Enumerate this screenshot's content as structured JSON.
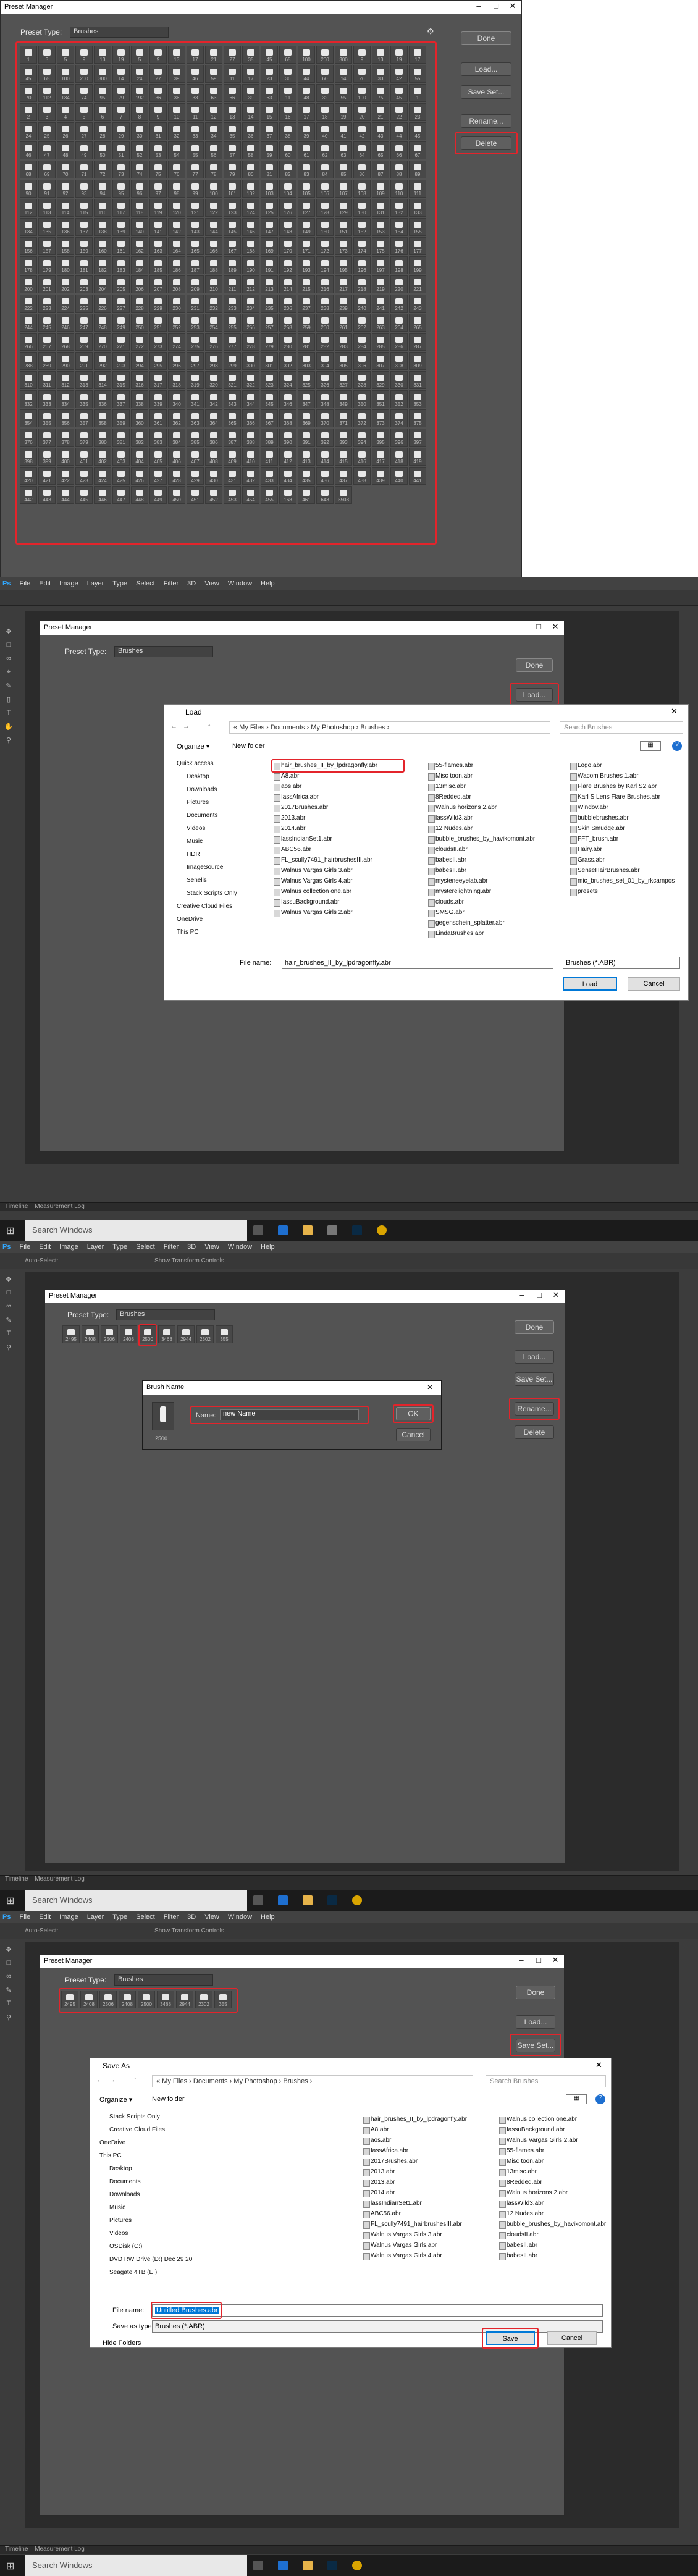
{
  "panel1": {
    "title": "Preset Manager",
    "preset_type_label": "Preset Type:",
    "preset_type_value": "Brushes",
    "buttons": {
      "done": "Done",
      "load": "Load...",
      "save": "Save Set...",
      "rename": "Rename...",
      "delete": "Delete"
    },
    "cell_labels": [
      "1",
      "3",
      "5",
      "9",
      "13",
      "19",
      "5",
      "9",
      "13",
      "17",
      "21",
      "27",
      "35",
      "45",
      "65",
      "100",
      "200",
      "300",
      "9",
      "13",
      "19",
      "17",
      "45",
      "65",
      "100",
      "200",
      "300",
      "14",
      "24",
      "27",
      "39",
      "46",
      "59",
      "11",
      "17",
      "23",
      "36",
      "44",
      "60",
      "14",
      "26",
      "33",
      "42",
      "55",
      "70",
      "112",
      "134",
      "74",
      "95",
      "29",
      "192",
      "36",
      "36",
      "33",
      "63",
      "66",
      "39",
      "63",
      "11",
      "48",
      "32",
      "55",
      "100",
      "75",
      "45",
      "1",
      "2",
      "3",
      "4",
      "5",
      "6",
      "7",
      "8",
      "9",
      "10",
      "11",
      "12",
      "13",
      "14",
      "15",
      "16",
      "17",
      "18",
      "19",
      "20",
      "21",
      "22",
      "23",
      "24",
      "25",
      "26",
      "27",
      "28",
      "29",
      "30",
      "31",
      "32",
      "33",
      "34",
      "35",
      "36",
      "37",
      "38",
      "39",
      "40",
      "41",
      "42",
      "43",
      "44",
      "45",
      "46",
      "47",
      "48",
      "49",
      "50",
      "51",
      "52",
      "53",
      "54",
      "55",
      "56",
      "57",
      "58",
      "59",
      "60",
      "61",
      "62",
      "63",
      "64",
      "65",
      "66",
      "67",
      "68",
      "69",
      "70",
      "71",
      "72",
      "73",
      "74",
      "75",
      "76",
      "77",
      "78",
      "79",
      "80",
      "81",
      "82",
      "83",
      "84",
      "85",
      "86",
      "87",
      "88",
      "89",
      "90",
      "91",
      "92",
      "93",
      "94",
      "95",
      "96",
      "97",
      "98",
      "99",
      "100",
      "101",
      "102",
      "103",
      "104",
      "105",
      "106",
      "107",
      "108",
      "109",
      "110",
      "111",
      "112",
      "113",
      "114",
      "115",
      "116",
      "117",
      "118",
      "119",
      "120",
      "121",
      "122",
      "123",
      "124",
      "125",
      "126",
      "127",
      "128",
      "129",
      "130",
      "131",
      "132",
      "133",
      "134",
      "135",
      "136",
      "137",
      "138",
      "139",
      "140",
      "141",
      "142",
      "143",
      "144",
      "145",
      "146",
      "147",
      "148",
      "149",
      "150",
      "151",
      "152",
      "153",
      "154",
      "155",
      "156",
      "157",
      "158",
      "159",
      "160",
      "161",
      "162",
      "163",
      "164",
      "165",
      "166",
      "167",
      "168",
      "169",
      "170",
      "171",
      "172",
      "173",
      "174",
      "175",
      "176",
      "177",
      "178",
      "179",
      "180",
      "181",
      "182",
      "183",
      "184",
      "185",
      "186",
      "187",
      "188",
      "189",
      "190",
      "191",
      "192",
      "193",
      "194",
      "195",
      "196",
      "197",
      "198",
      "199",
      "200",
      "201",
      "202",
      "203",
      "204",
      "205",
      "206",
      "207",
      "208",
      "209",
      "210",
      "211",
      "212",
      "213",
      "214",
      "215",
      "216",
      "217",
      "218",
      "219",
      "220",
      "221",
      "222",
      "223",
      "224",
      "225",
      "226",
      "227",
      "228",
      "229",
      "230",
      "231",
      "232",
      "233",
      "234",
      "235",
      "236",
      "237",
      "238",
      "239",
      "240",
      "241",
      "242",
      "243",
      "244",
      "245",
      "246",
      "247",
      "248",
      "249",
      "250",
      "251",
      "252",
      "253",
      "254",
      "255",
      "256",
      "257",
      "258",
      "259",
      "260",
      "261",
      "262",
      "263",
      "264",
      "265",
      "266",
      "267",
      "268",
      "269",
      "270",
      "271",
      "272",
      "273",
      "274",
      "275",
      "276",
      "277",
      "278",
      "279",
      "280",
      "281",
      "282",
      "283",
      "284",
      "285",
      "286",
      "287",
      "288",
      "289",
      "290",
      "291",
      "292",
      "293",
      "294",
      "295",
      "296",
      "297",
      "298",
      "299",
      "300",
      "301",
      "302",
      "303",
      "304",
      "305",
      "306",
      "307",
      "308",
      "309",
      "310",
      "311",
      "312",
      "313",
      "314",
      "315",
      "316",
      "317",
      "318",
      "319",
      "320",
      "321",
      "322",
      "323",
      "324",
      "325",
      "326",
      "327",
      "328",
      "329",
      "330",
      "331",
      "332",
      "333",
      "334",
      "335",
      "336",
      "337",
      "338",
      "339",
      "340",
      "341",
      "342",
      "343",
      "344",
      "345",
      "346",
      "347",
      "348",
      "349",
      "350",
      "351",
      "352",
      "353",
      "354",
      "355",
      "356",
      "357",
      "358",
      "359",
      "360",
      "361",
      "362",
      "363",
      "364",
      "365",
      "366",
      "367",
      "368",
      "369",
      "370",
      "371",
      "372",
      "373",
      "374",
      "375",
      "376",
      "377",
      "378",
      "379",
      "380",
      "381",
      "382",
      "383",
      "384",
      "385",
      "386",
      "387",
      "388",
      "389",
      "390",
      "391",
      "392",
      "393",
      "394",
      "395",
      "396",
      "397",
      "398",
      "399",
      "400",
      "401",
      "402",
      "403",
      "404",
      "405",
      "406",
      "407",
      "408",
      "409",
      "410",
      "411",
      "412",
      "413",
      "414",
      "415",
      "416",
      "417",
      "418",
      "419",
      "420",
      "421",
      "422",
      "423",
      "424",
      "425",
      "426",
      "427",
      "428",
      "429",
      "430",
      "431",
      "432",
      "433",
      "434",
      "435",
      "436",
      "437",
      "438",
      "439",
      "440",
      "441",
      "442",
      "443",
      "444",
      "445",
      "446",
      "447",
      "448",
      "449",
      "450",
      "451",
      "452",
      "453",
      "454",
      "455",
      "456",
      "457",
      "458",
      "459",
      "460",
      "461",
      "462",
      "463",
      "464",
      "465",
      "466",
      "467",
      "468",
      "469",
      "470",
      "471",
      "472",
      "473",
      "474",
      "475",
      "476",
      "477",
      "478",
      "479",
      "480",
      "481",
      "482",
      "483",
      "484",
      "485",
      "486",
      "487",
      "488",
      "489",
      "490",
      "491",
      "492",
      "493",
      "494",
      "495",
      "496",
      "497",
      "498",
      "499",
      "500"
    ],
    "last_row_labels": [
      "168",
      "461",
      "643",
      "3508"
    ]
  },
  "menu": [
    "File",
    "Edit",
    "Image",
    "Layer",
    "Type",
    "Select",
    "Filter",
    "3D",
    "View",
    "Window",
    "Help"
  ],
  "ps_logo": "Ps",
  "status_tabs": {
    "timeline": "Timeline",
    "measurement": "Measurement Log"
  },
  "taskbar": {
    "search": "Search Windows"
  },
  "options": {
    "auto_select": "Auto-Select:",
    "layer": "Layer",
    "transform": "Show Transform Controls"
  },
  "panel2": {
    "pm_title": "Preset Manager",
    "preset_type_label": "Preset Type:",
    "preset_type_value": "Brushes",
    "buttons": {
      "done": "Done",
      "load": "Load..."
    },
    "load_dialog": {
      "title": "Load",
      "breadcrumb": "« My Files › Documents › My Photoshop › Brushes ›",
      "search_placeholder": "Search Brushes",
      "organize": "Organize ▾",
      "new_folder": "New folder",
      "nav": [
        "Quick access",
        "Desktop",
        "Downloads",
        "Pictures",
        "Documents",
        "Videos",
        "Music",
        "HDR",
        "ImageSource",
        "Senelis",
        "Stack Scripts Only",
        "Creative Cloud Files",
        "OneDrive",
        "This PC"
      ],
      "files_col1": [
        "hair_brushes_II_by_lpdragonfly.abr",
        "A8.abr",
        "aos.abr",
        "IassAfrica.abr",
        "2017Brushes.abr",
        "2013.abr",
        "2014.abr",
        "lassIndianSet1.abr",
        "ABC56.abr",
        "FL_scully7491_hairbrushesIII.abr",
        "Walnus Vargas Girls 3.abr",
        "Walnus Vargas Girls 4.abr",
        "Walnus collection one.abr",
        "IassuBackground.abr",
        "Walnus Vargas Girls 2.abr"
      ],
      "files_col2": [
        "55-flames.abr",
        "Misc toon.abr",
        "13misc.abr",
        "8Redded.abr",
        "Walnus horizons 2.abr",
        "lassWild3.abr",
        "12 Nudes.abr",
        "bubble_brushes_by_havikomont.abr",
        "cloudsII.abr",
        "babesII.abr",
        "babesII.abr",
        "mysteneeyelab.abr",
        "mysterelightning.abr",
        "clouds.abr",
        "SMSG.abr",
        "gegenschein_splatter.abr",
        "LindaBrushes.abr"
      ],
      "files_col3": [
        "Logo.abr",
        "Wacom Brushes 1.abr",
        "Flare Brushes by Karl S2.abr",
        "Karl S Lens Flare Brushes.abr",
        "Windov.abr",
        "bubblebrushes.abr",
        "Skin Smudge.abr",
        "FFT_brush.abr",
        "Hairy.abr",
        "Grass.abr",
        "SenseHairBrushes.abr",
        "mic_brushes_set_01_by_rkcampos",
        "presets"
      ],
      "file_name_label": "File name:",
      "file_name_value": "hair_brushes_II_by_lpdragonfly.abr",
      "file_type": "Brushes (*.ABR)",
      "load": "Load",
      "cancel": "Cancel"
    }
  },
  "panel3": {
    "pm_title": "Preset Manager",
    "preset_type_label": "Preset Type:",
    "preset_type_value": "Brushes",
    "brush_labels": [
      "2495",
      "2408",
      "2506",
      "2408",
      "2500",
      "3468",
      "2944",
      "2302",
      "355"
    ],
    "buttons": {
      "done": "Done",
      "load": "Load...",
      "save": "Save Set...",
      "rename": "Rename...",
      "delete": "Delete"
    },
    "rename_dialog": {
      "title": "Brush Name",
      "name_label": "Name:",
      "name_value": "new Name",
      "ok": "OK",
      "cancel": "Cancel",
      "size": "2500"
    }
  },
  "panel4": {
    "pm_title": "Preset Manager",
    "preset_type_label": "Preset Type:",
    "preset_type_value": "Brushes",
    "brush_labels": [
      "2495",
      "2408",
      "2506",
      "2408",
      "2500",
      "3468",
      "2944",
      "2302",
      "355"
    ],
    "buttons": {
      "done": "Done",
      "load": "Load...",
      "save": "Save Set..."
    },
    "save_dialog": {
      "title": "Save As",
      "breadcrumb": "« My Files › Documents › My Photoshop › Brushes ›",
      "search_placeholder": "Search Brushes",
      "organize": "Organize ▾",
      "new_folder": "New folder",
      "nav": [
        "Stack Scripts Only",
        "Creative Cloud Files",
        "OneDrive",
        "This PC",
        "Desktop",
        "Documents",
        "Downloads",
        "Music",
        "Pictures",
        "Videos",
        "OSDisk (C:)",
        "DVD RW Drive (D:) Dec 29 2016",
        "Seagate 4TB (E:)"
      ],
      "files_col1": [
        "hair_brushes_II_by_lpdragonfly.abr",
        "A8.abr",
        "aos.abr",
        "IassAfrica.abr",
        "2017Brushes.abr",
        "2013.abr",
        "2013.abr",
        "2014.abr",
        "lassIndianSet1.abr",
        "ABC56.abr",
        "FL_scully7491_hairbrushesIII.abr",
        "Walnus Vargas Girls 3.abr",
        "Walnus Vargas Girls.abr",
        "Walnus Vargas Girls 4.abr"
      ],
      "files_col2": [
        "Walnus collection one.abr",
        "IassuBackground.abr",
        "Walnus Vargas Girls 2.abr",
        "55-flames.abr",
        "Misc toon.abr",
        "13misc.abr",
        "8Redded.abr",
        "Walnus horizons 2.abr",
        "lassWild3.abr",
        "12 Nudes.abr",
        "bubble_brushes_by_havikomont.abr",
        "cloudsII.abr",
        "babesII.abr",
        "babesII.abr"
      ],
      "file_name_label": "File name:",
      "file_name_value": "Untitled Brushes.abr",
      "save_type_label": "Save as type:",
      "save_type_value": "Brushes (*.ABR)",
      "hide_folders": "Hide Folders",
      "save": "Save",
      "cancel": "Cancel"
    }
  }
}
